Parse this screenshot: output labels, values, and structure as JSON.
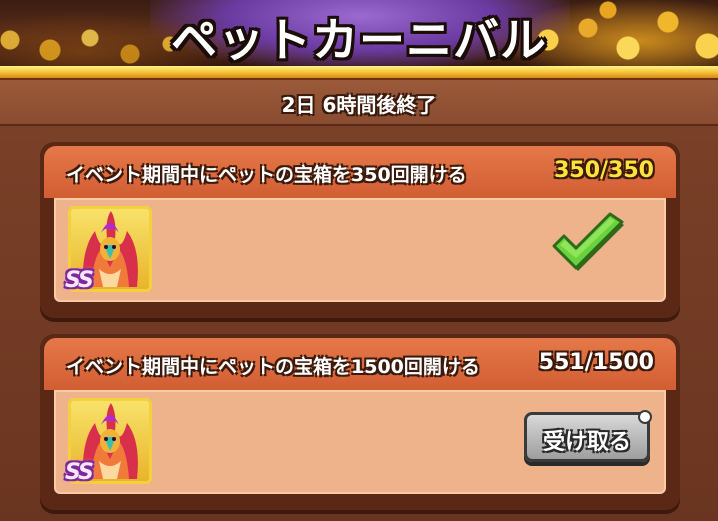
{
  "header": {
    "title": "ペットカーニバル",
    "decoration": "treasure-coins"
  },
  "timer": {
    "text": "2日 6時間後終了"
  },
  "missions": [
    {
      "description": "イベント期間中にペットの宝箱を350回開ける",
      "progress": "350/350",
      "progress_color": "#ffe23a",
      "reward": {
        "icon": "phoenix-pet-icon",
        "rank": "SS"
      },
      "status": "completed",
      "status_icon": "check-icon"
    },
    {
      "description": "イベント期間中にペットの宝箱を1500回開ける",
      "progress": "551/1500",
      "progress_color": "#ffffff",
      "reward": {
        "icon": "phoenix-pet-icon",
        "rank": "SS"
      },
      "status": "claimable",
      "action_label": "受け取る"
    }
  ],
  "colors": {
    "card_header": "#d25e34",
    "card_body": "#eeb38a",
    "check_green": "#6ad23a",
    "gold": "#f6c53a"
  }
}
